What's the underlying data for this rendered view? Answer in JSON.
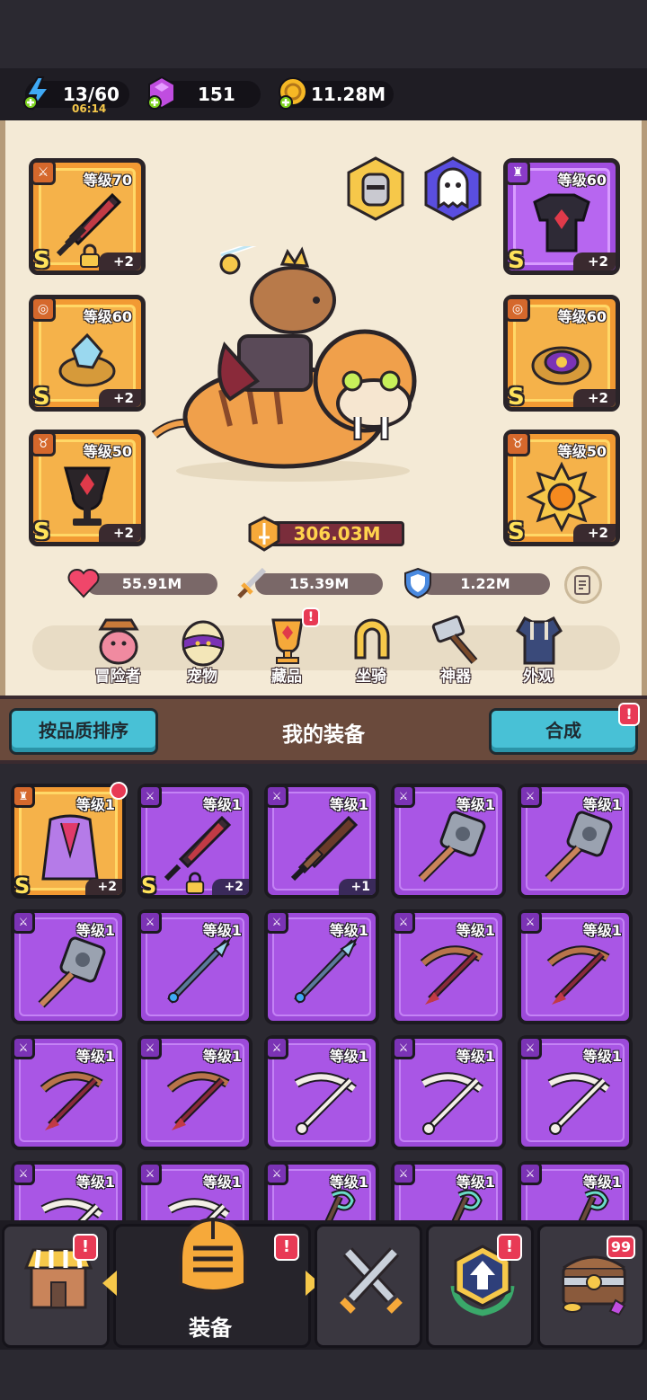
{
  "resources": {
    "energy": {
      "value": "13/60",
      "timer": "06:14"
    },
    "gems": {
      "value": "151"
    },
    "coins": {
      "value": "11.28M"
    }
  },
  "hero": {
    "equipped": {
      "weapon": {
        "level": "等级70",
        "grade": "S",
        "plus": "+2"
      },
      "armor": {
        "level": "等级60",
        "grade": "S",
        "plus": "+2"
      },
      "ring_left": {
        "level": "等级60",
        "grade": "S",
        "plus": "+2"
      },
      "ring_right": {
        "level": "等级60",
        "grade": "S",
        "plus": "+2"
      },
      "necklace": {
        "level": "等级50",
        "grade": "S",
        "plus": "+2"
      },
      "medal": {
        "level": "等级50",
        "grade": "S",
        "plus": "+2"
      }
    },
    "power": "306.03M",
    "stats": {
      "hp": "55.91M",
      "attack": "15.39M",
      "defense": "1.22M"
    },
    "tabs": [
      "冒险者",
      "宠物",
      "藏品",
      "坐骑",
      "神器",
      "外观"
    ]
  },
  "toolbar": {
    "sort_label": "按品质排序",
    "title": "我的装备",
    "merge_label": "合成"
  },
  "inventory": {
    "items": [
      {
        "level": "等级1",
        "grade": "S",
        "plus": "+2",
        "rarity": "orange",
        "item": "cloak"
      },
      {
        "level": "等级1",
        "grade": "S",
        "plus": "+2",
        "rarity": "purple",
        "item": "dark-sword"
      },
      {
        "level": "等级1",
        "grade": "",
        "plus": "+1",
        "rarity": "purple",
        "item": "wood-sword"
      },
      {
        "level": "等级1",
        "grade": "",
        "plus": "",
        "rarity": "purple",
        "item": "hammer"
      },
      {
        "level": "等级1",
        "grade": "",
        "plus": "",
        "rarity": "purple",
        "item": "hammer"
      },
      {
        "level": "等级1",
        "grade": "",
        "plus": "",
        "rarity": "purple",
        "item": "hammer"
      },
      {
        "level": "等级1",
        "grade": "",
        "plus": "",
        "rarity": "purple",
        "item": "spear"
      },
      {
        "level": "等级1",
        "grade": "",
        "plus": "",
        "rarity": "purple",
        "item": "spear"
      },
      {
        "level": "等级1",
        "grade": "",
        "plus": "",
        "rarity": "purple",
        "item": "crossbow"
      },
      {
        "level": "等级1",
        "grade": "",
        "plus": "",
        "rarity": "purple",
        "item": "crossbow"
      },
      {
        "level": "等级1",
        "grade": "",
        "plus": "",
        "rarity": "purple",
        "item": "crossbow"
      },
      {
        "level": "等级1",
        "grade": "",
        "plus": "",
        "rarity": "purple",
        "item": "crossbow"
      },
      {
        "level": "等级1",
        "grade": "",
        "plus": "",
        "rarity": "purple",
        "item": "bone-bow"
      },
      {
        "level": "等级1",
        "grade": "",
        "plus": "",
        "rarity": "purple",
        "item": "bone-bow"
      },
      {
        "level": "等级1",
        "grade": "",
        "plus": "",
        "rarity": "purple",
        "item": "bone-bow"
      },
      {
        "level": "等级1",
        "grade": "",
        "plus": "",
        "rarity": "purple",
        "item": "bone-bow"
      },
      {
        "level": "等级1",
        "grade": "",
        "plus": "",
        "rarity": "purple",
        "item": "bone-bow"
      },
      {
        "level": "等级1",
        "grade": "",
        "plus": "",
        "rarity": "purple",
        "item": "staff"
      },
      {
        "level": "等级1",
        "grade": "",
        "plus": "",
        "rarity": "purple",
        "item": "staff"
      },
      {
        "level": "等级1",
        "grade": "",
        "plus": "",
        "rarity": "purple",
        "item": "staff"
      }
    ]
  },
  "nav": {
    "active_label": "装备",
    "chest_count": "99"
  },
  "colors": {
    "purple": "#a956e5",
    "orange": "#f5b24a",
    "accent": "#48c1d6",
    "badge": "#e83a55"
  }
}
